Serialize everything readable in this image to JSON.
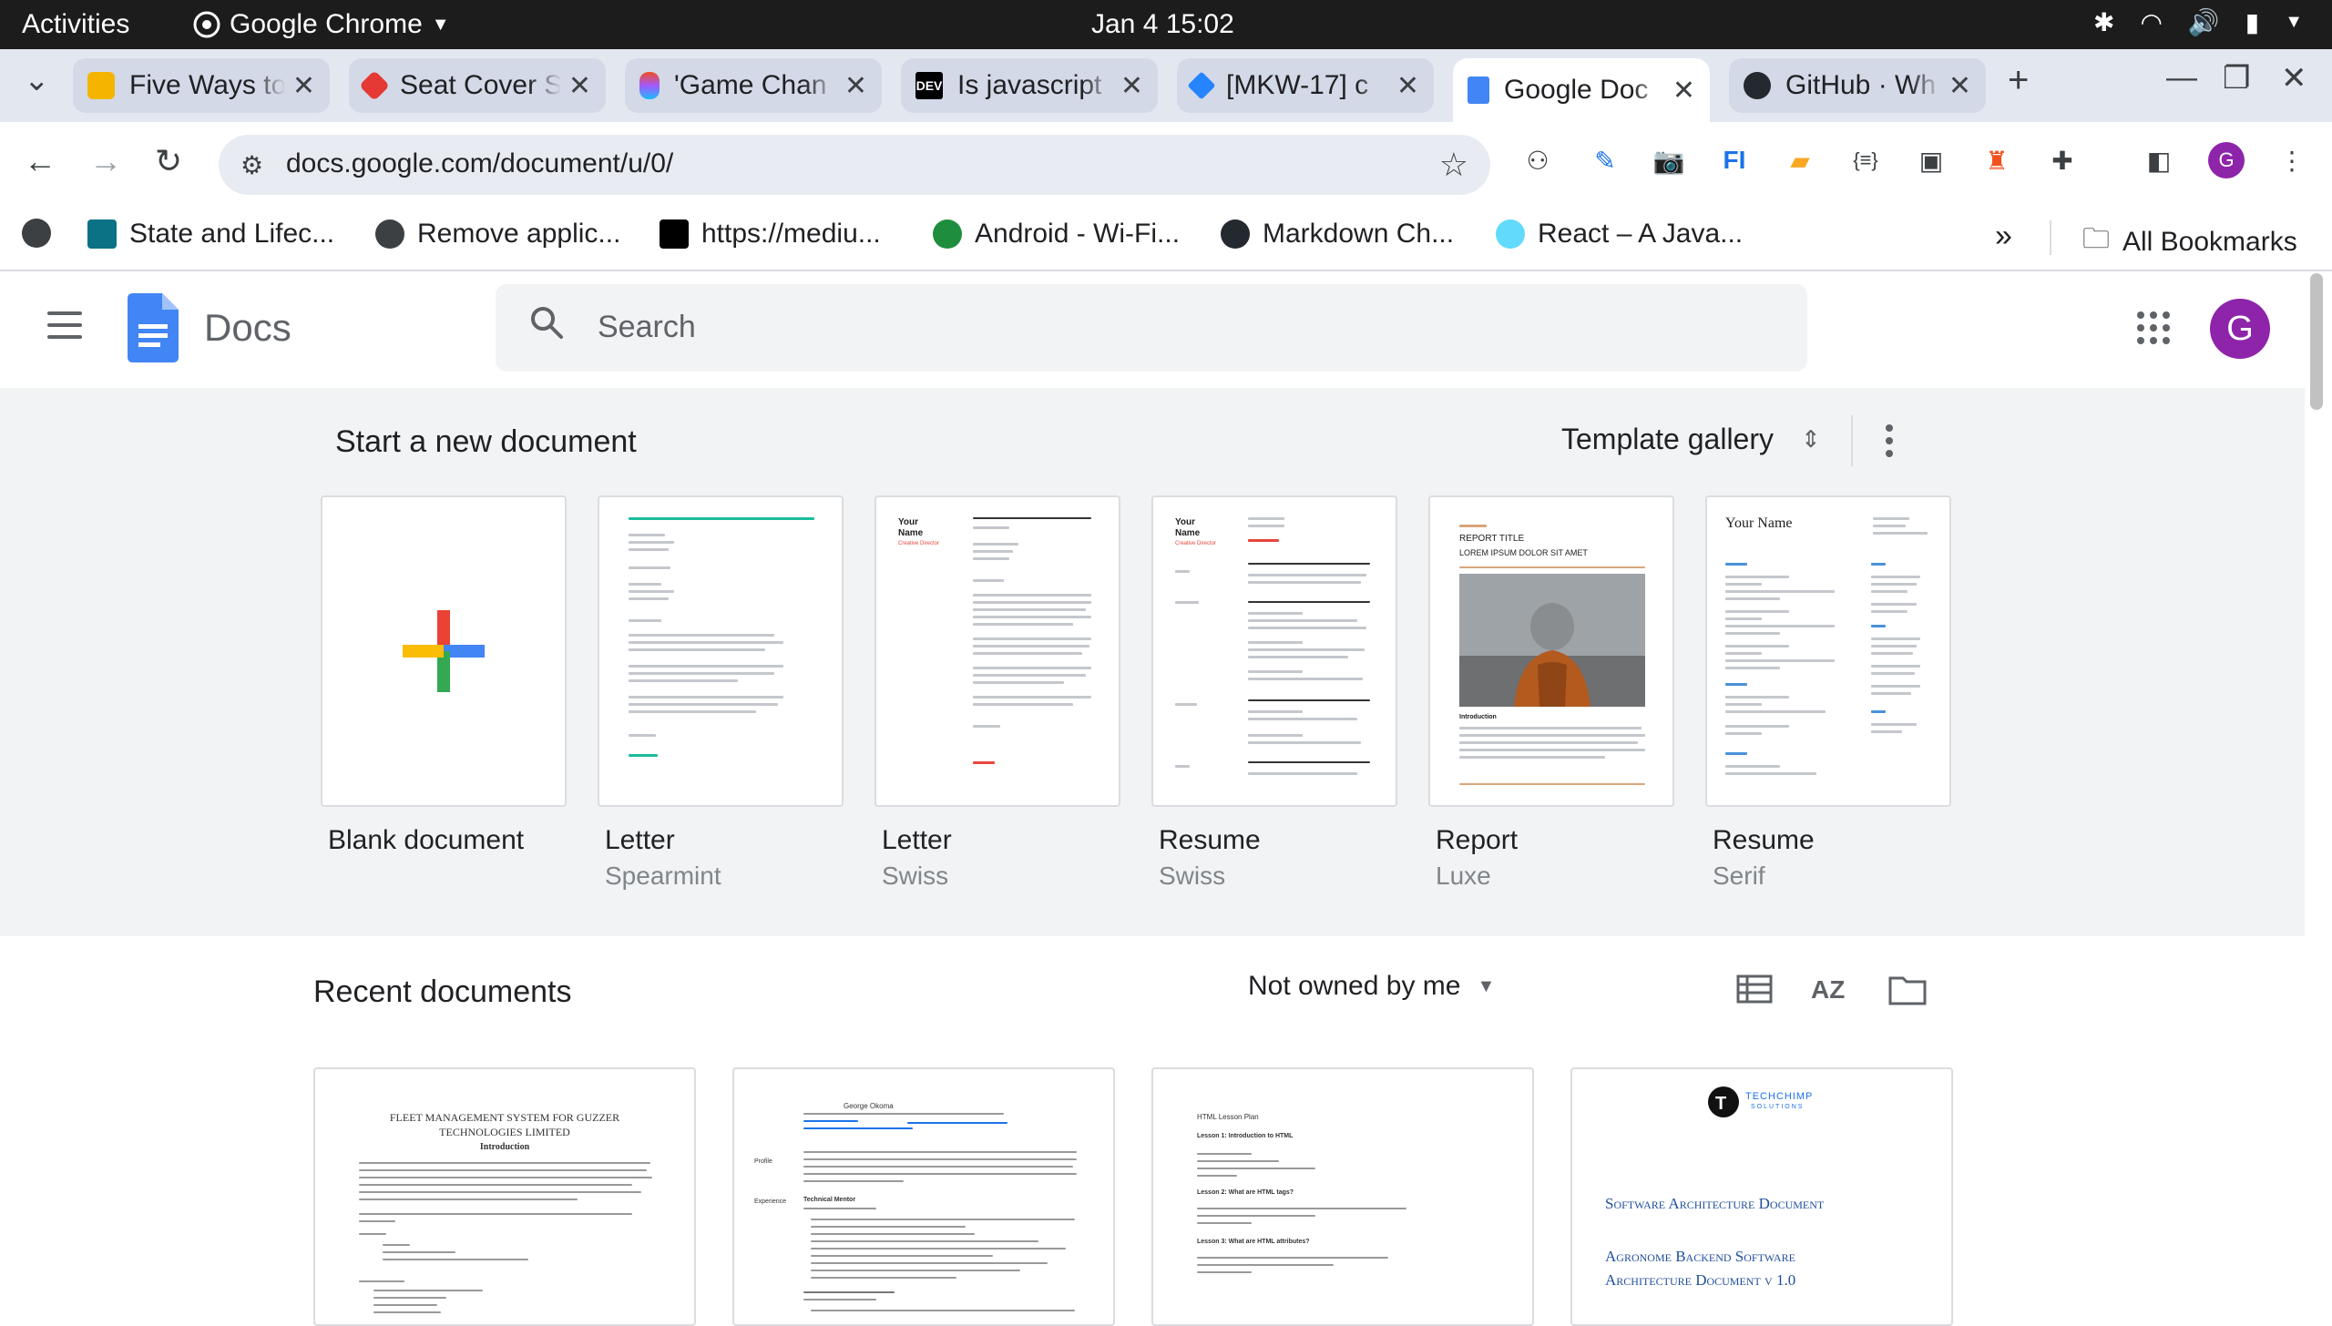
{
  "system_bar": {
    "activities": "Activities",
    "app_name": "Google Chrome",
    "clock": "Jan 4  15:02"
  },
  "browser": {
    "tabs": [
      {
        "title": "Five Ways to",
        "color": "#f4b400"
      },
      {
        "title": "Seat Cover S",
        "color": "#e53935"
      },
      {
        "title": "'Game Chan",
        "color": "#a259ff"
      },
      {
        "title": "Is javascript",
        "color": "#000000",
        "badge": "DEV"
      },
      {
        "title": "[MKW-17] c",
        "color": "#2684ff"
      },
      {
        "title": "Google Doc",
        "color": "#4285f4"
      },
      {
        "title": "GitHub · Wh",
        "color": "#24292f"
      }
    ],
    "url": "docs.google.com/document/u/0/",
    "profile_initial": "G",
    "bookmarks": [
      {
        "label": "State and Lifec...",
        "icon": "react-icon"
      },
      {
        "label": "Remove applic...",
        "icon": "globe-icon"
      },
      {
        "label": "https://mediu...",
        "icon": "medium-icon"
      },
      {
        "label": "Android - Wi-Fi...",
        "icon": "android-icon"
      },
      {
        "label": "Markdown Ch...",
        "icon": "github-icon"
      },
      {
        "label": "React – A Java...",
        "icon": "react-icon"
      }
    ],
    "all_bookmarks": "All Bookmarks"
  },
  "docs": {
    "app_title": "Docs",
    "search_placeholder": "Search",
    "avatar_initial": "G",
    "templates": {
      "heading": "Start a new document",
      "gallery_label": "Template gallery",
      "items": [
        {
          "name": "Blank document",
          "sub": ""
        },
        {
          "name": "Letter",
          "sub": "Spearmint"
        },
        {
          "name": "Letter",
          "sub": "Swiss"
        },
        {
          "name": "Resume",
          "sub": "Swiss"
        },
        {
          "name": "Report",
          "sub": "Luxe"
        },
        {
          "name": "Resume",
          "sub": "Serif"
        }
      ],
      "thumb_text": {
        "swiss_letter_name": "Your Name",
        "swiss_letter_role": "Creative Director",
        "resume_name": "Your Name",
        "resume_role": "Creative Director",
        "report_kicker": "REPORT TITLE",
        "report_sub": "LOREM IPSUM DOLOR SIT AMET",
        "report_section": "Introduction",
        "serif_name": "Your Name"
      }
    },
    "recent": {
      "heading": "Recent documents",
      "owner_filter": "Not owned by me",
      "docs": [
        {
          "title_line1": "FLEET MANAGEMENT SYSTEM FOR GUZZER",
          "title_line2": "TECHNOLOGIES LIMITED",
          "section": "Introduction"
        },
        {
          "name": "George Okoma",
          "left_labels": [
            "Profile",
            "Experience"
          ],
          "role": "Technical Mentor"
        },
        {
          "title": "HTML Lesson Plan",
          "lessons": [
            "Lesson 1: Introduction to HTML",
            "Lesson 2: What are HTML tags?",
            "Lesson 3: What are HTML attributes?"
          ]
        },
        {
          "logo": "TECHCHIMP",
          "logo_sub": "SOLUTIONS",
          "title": "Software Architecture Document",
          "subtitle_line1": "Agronome Backend Software",
          "subtitle_line2": "Architecture Document v 1.0"
        }
      ]
    }
  }
}
